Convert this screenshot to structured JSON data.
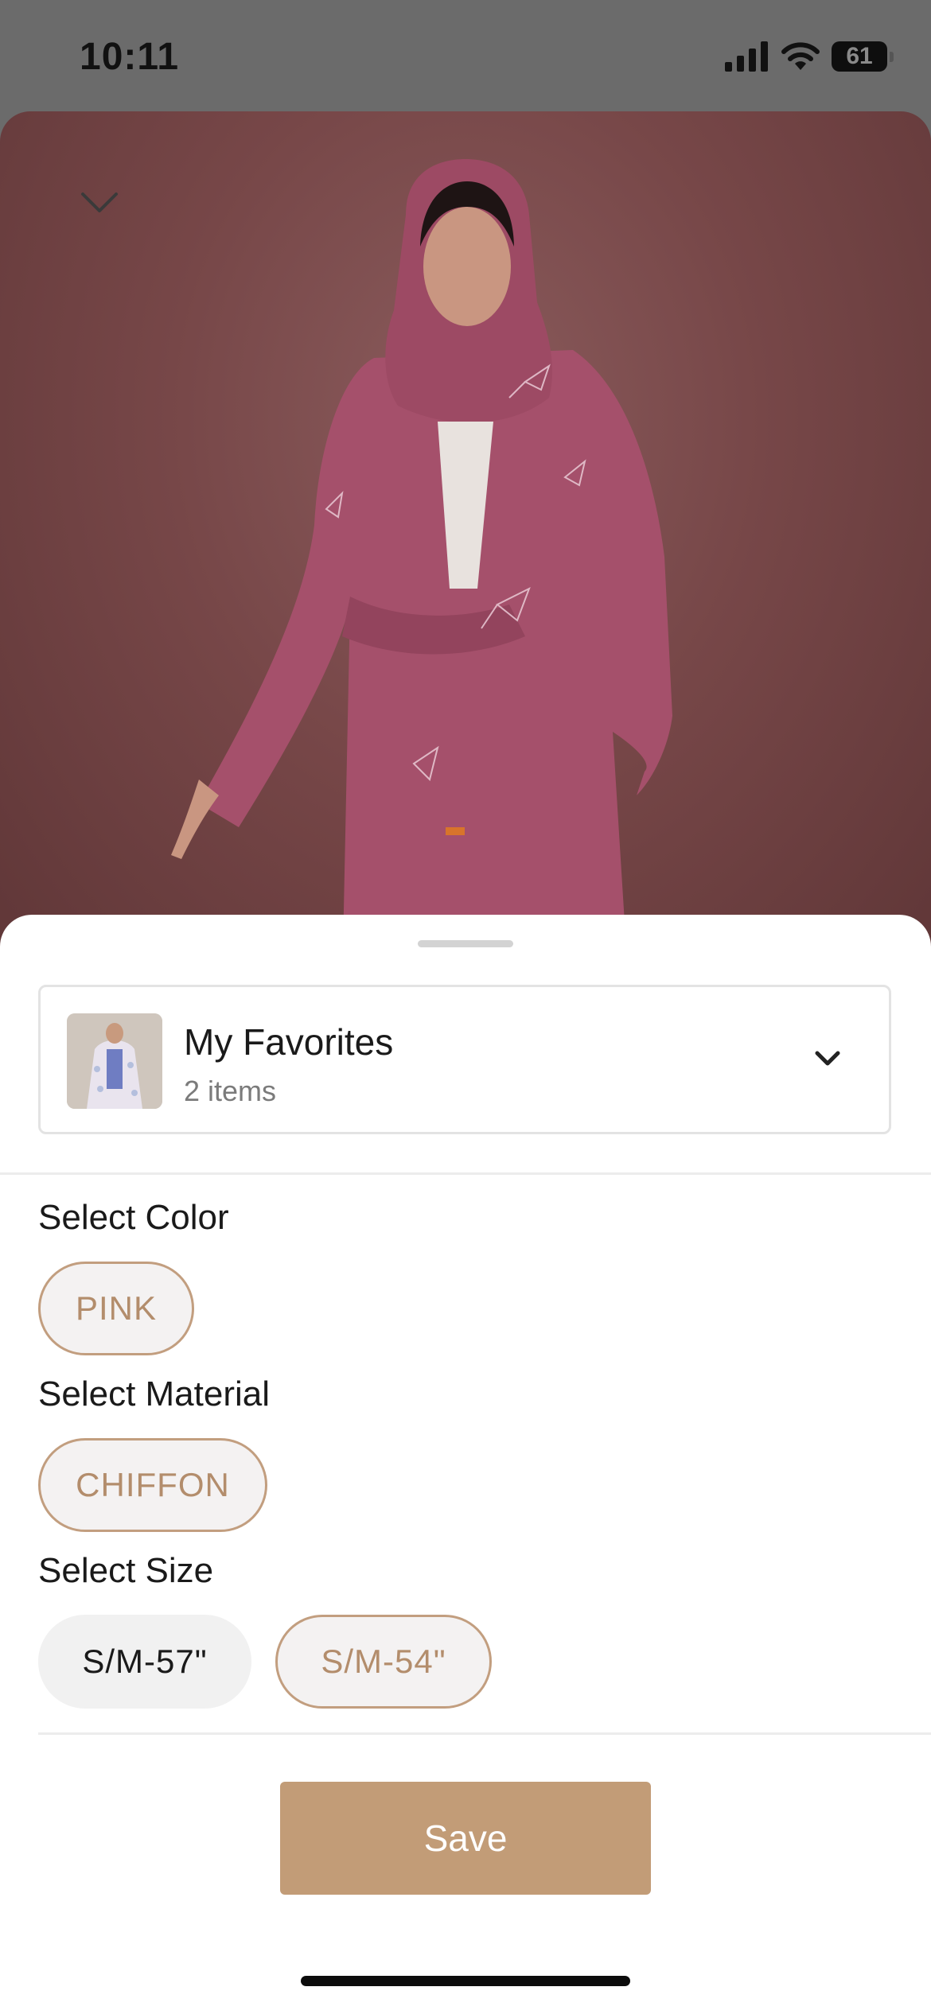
{
  "status_bar": {
    "time": "10:11",
    "battery_level": "61",
    "icons": [
      "cellular-signal-icon",
      "wifi-icon",
      "battery-icon"
    ]
  },
  "product": {
    "image_icon": "product-photo",
    "collapse_icon": "chevron-down-icon",
    "dress_color": "#a5506b"
  },
  "sheet": {
    "list": {
      "name": "My Favorites",
      "count": "2 items",
      "dropdown_icon": "chevron-down-icon"
    },
    "color": {
      "label": "Select Color",
      "options": [
        "PINK"
      ],
      "selected": "PINK"
    },
    "material": {
      "label": "Select Material",
      "options": [
        "CHIFFON"
      ],
      "selected": "CHIFFON"
    },
    "size": {
      "label": "Select Size",
      "options": [
        "S/M-57\"",
        "S/M-54\""
      ],
      "selected": "S/M-54\""
    },
    "save_label": "Save"
  },
  "colors": {
    "accent": "#c29c77",
    "chip_selected_text": "#b38d6c",
    "chip_border": "#c29e7f"
  }
}
